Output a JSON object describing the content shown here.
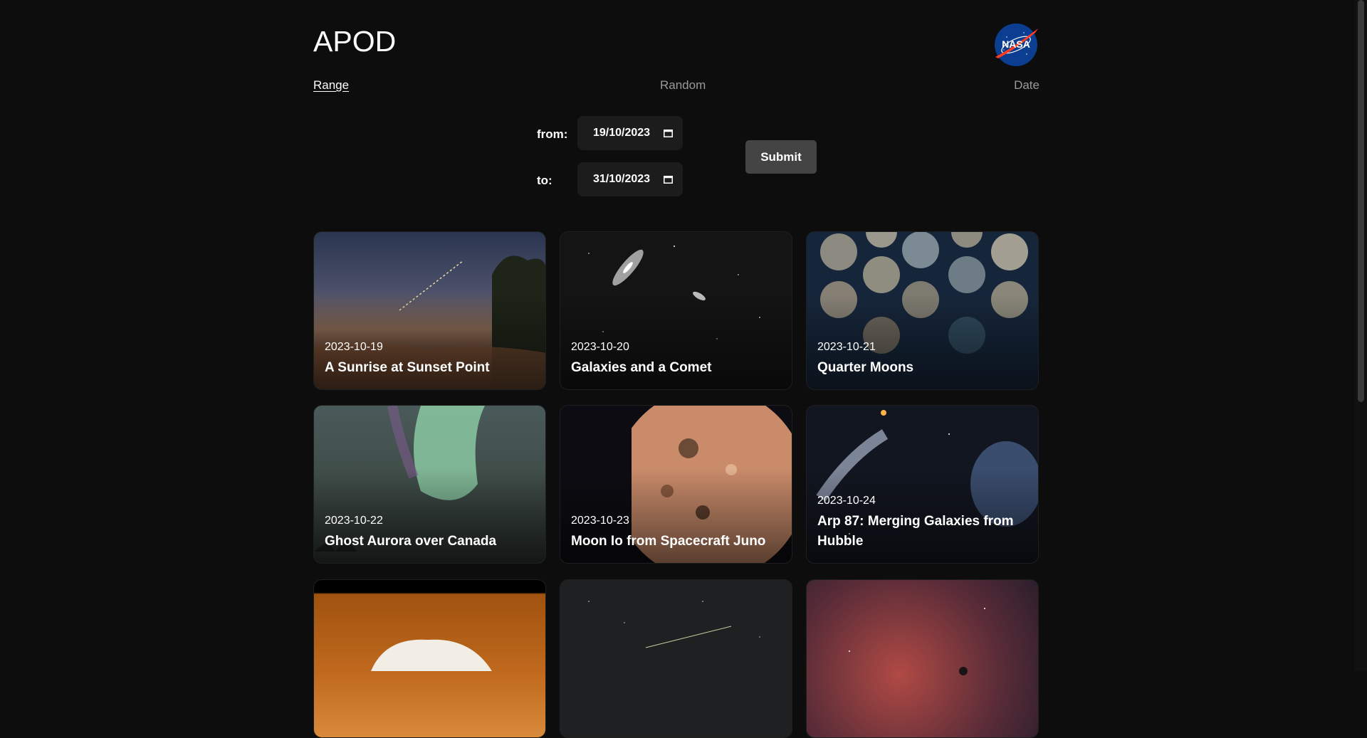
{
  "app": {
    "title": "APOD",
    "logo_label": "NASA"
  },
  "nav": {
    "range": "Range",
    "random": "Random",
    "date": "Date"
  },
  "form": {
    "from_label": "from:",
    "from_value": "19/10/2023",
    "to_label": "to:",
    "to_value": "31/10/2023",
    "submit_label": "Submit"
  },
  "cards": [
    {
      "date": "2023-10-19",
      "title": "A Sunrise at Sunset Point"
    },
    {
      "date": "2023-10-20",
      "title": "Galaxies and a Comet"
    },
    {
      "date": "2023-10-21",
      "title": "Quarter Moons"
    },
    {
      "date": "2023-10-22",
      "title": "Ghost Aurora over Canada"
    },
    {
      "date": "2023-10-23",
      "title": "Moon Io from Spacecraft Juno"
    },
    {
      "date": "2023-10-24",
      "title": "Arp 87: Merging Galaxies from Hubble"
    },
    {
      "date": "",
      "title": ""
    },
    {
      "date": "",
      "title": ""
    },
    {
      "date": "",
      "title": ""
    }
  ],
  "colors": {
    "background": "#0d0d0d",
    "nav_inactive": "#9a9a9a",
    "input_bg": "#1c1c1c",
    "button_bg": "#444444"
  }
}
